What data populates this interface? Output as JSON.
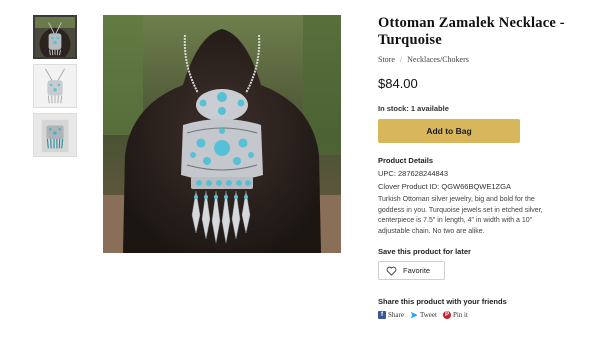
{
  "product": {
    "title": "Ottoman Zamalek Necklace - Turquoise",
    "price": "$84.00",
    "stock": "In stock: 1 available",
    "add_to_bag": "Add to Bag"
  },
  "breadcrumb": {
    "items": [
      "Store",
      "Necklaces/Chokers"
    ],
    "separator": "/"
  },
  "details": {
    "heading": "Product Details",
    "upc": "UPC: 287628244843",
    "clover_id": "Clover Product ID: QGW66BQWE1ZGA",
    "description": "Turkish Ottoman silver jewelry, big and bold for the goddess in you. Turquoise jewels set in etched silver, centerpiece is 7.5\" in length, 4\" in width with a 10\" adjustable chain. No two are alike."
  },
  "save": {
    "heading": "Save this product for later",
    "favorite_label": "Favorite"
  },
  "share": {
    "heading": "Share this product with your friends",
    "facebook": "Share",
    "twitter": "Tweet",
    "pinterest": "Pin it"
  },
  "colors": {
    "accent_button": "#d8b65c",
    "facebook": "#3b5998",
    "twitter": "#1da1f2",
    "pinterest": "#cb2027"
  }
}
